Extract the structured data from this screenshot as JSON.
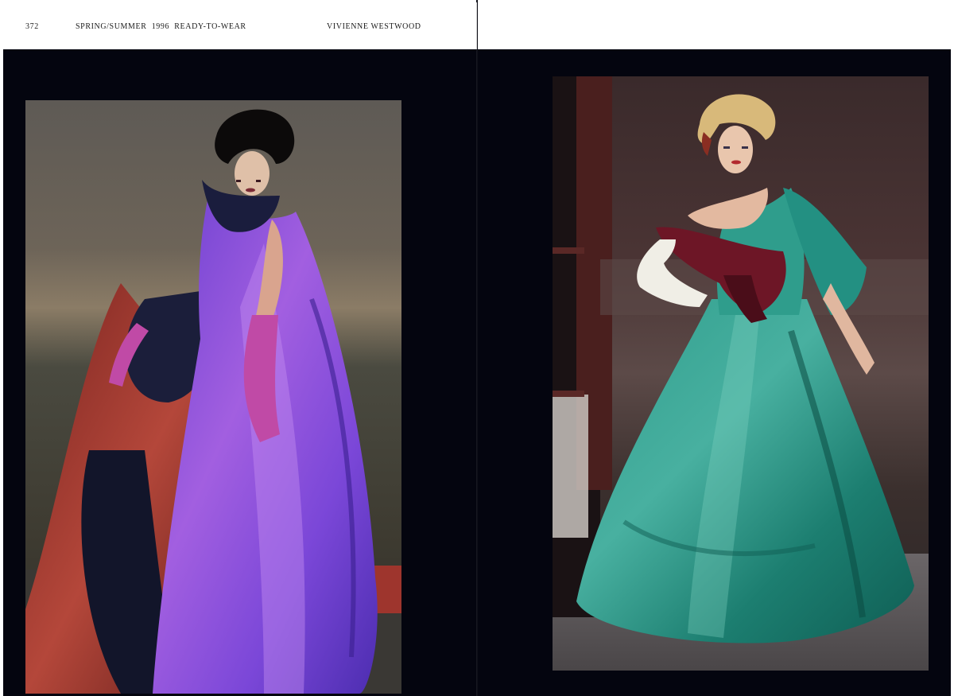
{
  "spread": {
    "left_page": {
      "folio": "372",
      "section": "SPRING/SUMMER  1996  READY-TO-WEAR",
      "designer": "VIVIENNE WESTWOOD"
    },
    "right_page": {}
  },
  "photos": {
    "left": {
      "dress_color": "#8a4fd6",
      "underskirt_color": "#a3352c",
      "bow_color": "#1b1e3a",
      "glove_color": "#c04aa6",
      "backdrop_color": "#6d6458"
    },
    "right": {
      "dress_color": "#1f8a7a",
      "sash_color": "#6d1626",
      "glove_color": "#f0eee6",
      "backdrop_color": "#3e2d2e"
    }
  },
  "colors": {
    "page_background": "#04050f",
    "header_background": "#ffffff",
    "header_text": "#1a1a1a"
  }
}
